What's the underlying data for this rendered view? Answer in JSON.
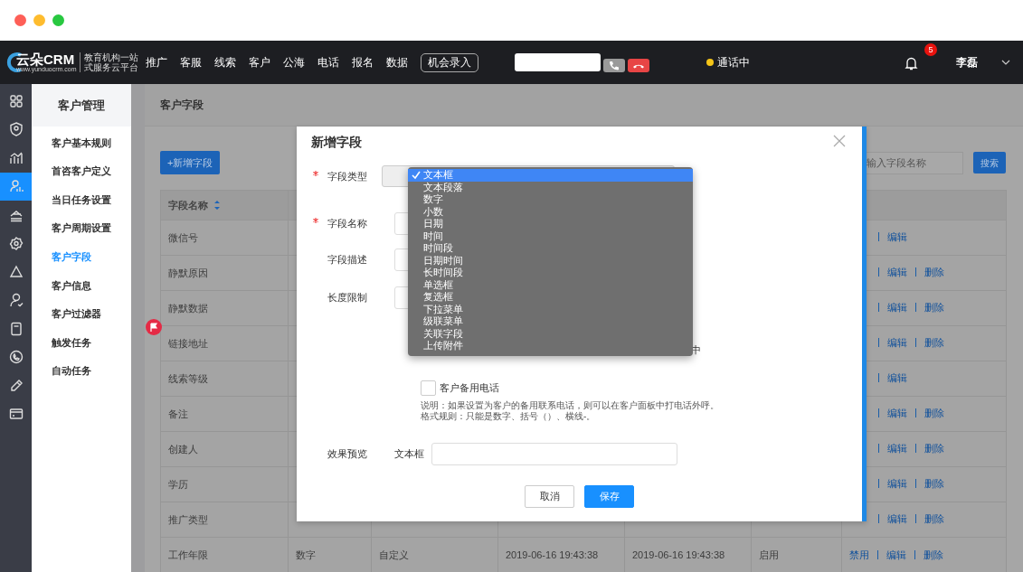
{
  "window": {
    "controls": [
      {
        "color": "#fe5f57"
      },
      {
        "color": "#febc2e"
      },
      {
        "color": "#28c840"
      }
    ]
  },
  "top_nav": {
    "logo": {
      "name": "云朵CRM",
      "url": "www.yunduocrm.com",
      "tagline": [
        "教育机构一站",
        "式服务云平台"
      ]
    },
    "menu": [
      "推广",
      "客服",
      "线索",
      "客户",
      "公海",
      "电话",
      "报名",
      "数据"
    ],
    "opportunity_button": "机会录入",
    "call_status": "通话中",
    "notification_count": "5",
    "user": "李磊"
  },
  "icon_rail": [
    {
      "selected": false
    },
    {
      "selected": false
    },
    {
      "selected": false
    },
    {
      "selected": true
    },
    {
      "selected": false
    },
    {
      "selected": false
    },
    {
      "selected": false
    },
    {
      "selected": false
    },
    {
      "selected": false
    },
    {
      "selected": false
    },
    {
      "selected": false
    },
    {
      "selected": false
    }
  ],
  "sidebar": {
    "title": "客户管理",
    "items": [
      {
        "label": "客户基本规则",
        "selected": false
      },
      {
        "label": "首咨客户定义",
        "selected": false
      },
      {
        "label": "当日任务设置",
        "selected": false
      },
      {
        "label": "客户周期设置",
        "selected": false
      },
      {
        "label": "客户字段",
        "selected": true
      },
      {
        "label": "客户信息",
        "selected": false
      },
      {
        "label": "客户过滤器",
        "selected": false
      },
      {
        "label": "触发任务",
        "selected": false
      },
      {
        "label": "自动任务",
        "selected": false
      }
    ]
  },
  "page": {
    "title": "客户字段",
    "add_button": "+新增字段",
    "search": {
      "placeholder": "输入字段名称"
    },
    "search_button": "搜索"
  },
  "table": {
    "columns": [
      {
        "label": "字段名称",
        "sortable": true
      }
    ],
    "rows": [
      {
        "name": "微信号",
        "covered": true,
        "actions": [
          "编辑"
        ]
      },
      {
        "name": "静默原因",
        "covered": true,
        "actions": [
          "编辑",
          "删除"
        ]
      },
      {
        "name": "静默数据",
        "covered": true,
        "actions": [
          "编辑",
          "删除"
        ]
      },
      {
        "name": "链接地址",
        "covered": true,
        "actions": [
          "编辑",
          "删除"
        ]
      },
      {
        "name": "线索等级",
        "covered": true,
        "actions": [
          "编辑"
        ]
      },
      {
        "name": "备注",
        "covered": true,
        "actions": [
          "编辑",
          "删除"
        ]
      },
      {
        "name": "创建人",
        "covered": true,
        "actions": [
          "编辑",
          "删除"
        ]
      },
      {
        "name": "学历",
        "covered": true,
        "actions": [
          "编辑",
          "删除"
        ]
      },
      {
        "name": "推广类型",
        "covered": true,
        "actions": [
          "编辑",
          "删除"
        ]
      },
      {
        "name": "工作年限",
        "covered": false,
        "cells": [
          "数字",
          "自定义",
          "2019-06-16 19:43:38",
          "2019-06-16 19:43:38",
          "启用"
        ],
        "actions": [
          "禁用",
          "编辑",
          "删除"
        ]
      }
    ]
  },
  "modal": {
    "title": "新增字段",
    "fields": [
      {
        "label": "字段类型",
        "required": true,
        "kind": "select"
      },
      {
        "label": "字段名称",
        "required": true,
        "kind": "input"
      },
      {
        "label": "字段描述",
        "required": false,
        "kind": "input"
      },
      {
        "label": "长度限制",
        "required": false,
        "kind": "input"
      }
    ],
    "covered_option_text": "中",
    "checkbox": {
      "label": "客户备用电话",
      "checked": false
    },
    "note": [
      "说明：如果设置为客户的备用联系电话，则可以在客户面板中打电话外呼。",
      "格式规则：只能是数字、括号（）、横线-。"
    ],
    "preview": {
      "label": "效果预览",
      "type_label": "文本框"
    },
    "buttons": [
      {
        "label": "取消",
        "kind": "secondary"
      },
      {
        "label": "保存",
        "kind": "primary"
      }
    ]
  },
  "dropdown": {
    "options": [
      {
        "label": "文本框",
        "selected": true
      },
      {
        "label": "文本段落",
        "selected": false
      },
      {
        "label": "数字",
        "selected": false
      },
      {
        "label": "小数",
        "selected": false
      },
      {
        "label": "日期",
        "selected": false
      },
      {
        "label": "时间",
        "selected": false
      },
      {
        "label": "时间段",
        "selected": false
      },
      {
        "label": "日期时间",
        "selected": false
      },
      {
        "label": "长时间段",
        "selected": false
      },
      {
        "label": "单选框",
        "selected": false
      },
      {
        "label": "复选框",
        "selected": false
      },
      {
        "label": "下拉菜单",
        "selected": false
      },
      {
        "label": "级联菜单",
        "selected": false
      },
      {
        "label": "关联字段",
        "selected": false
      },
      {
        "label": "上传附件",
        "selected": false
      }
    ]
  }
}
